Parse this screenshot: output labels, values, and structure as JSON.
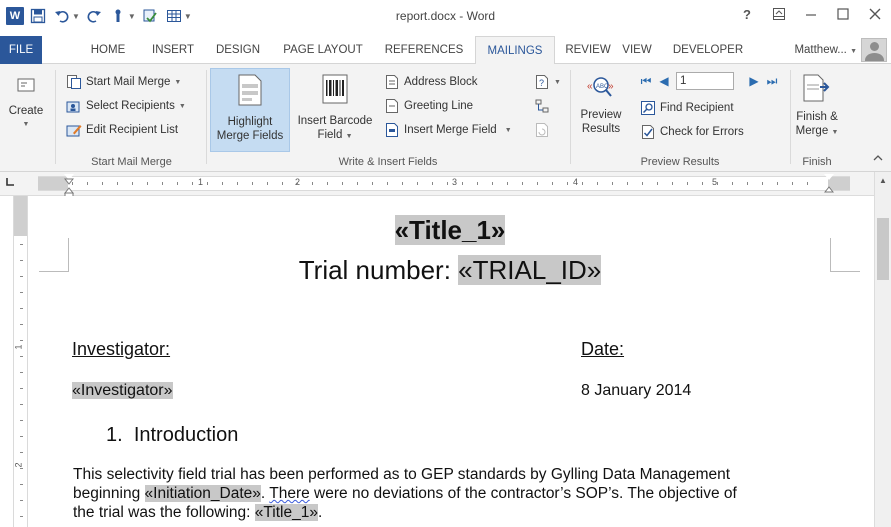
{
  "window": {
    "title": "report.docx - Word",
    "help": "?",
    "controls": [
      "restore-ribbon",
      "minimize",
      "maximize",
      "close"
    ]
  },
  "quick_access": {
    "logo_text": "W"
  },
  "tabs": [
    {
      "label": "FILE"
    },
    {
      "label": "HOME"
    },
    {
      "label": "INSERT"
    },
    {
      "label": "DESIGN"
    },
    {
      "label": "PAGE LAYOUT"
    },
    {
      "label": "REFERENCES"
    },
    {
      "label": "MAILINGS"
    },
    {
      "label": "REVIEW"
    },
    {
      "label": "VIEW"
    },
    {
      "label": "DEVELOPER"
    }
  ],
  "active_tab": "MAILINGS",
  "account": "Matthew...",
  "ribbon": {
    "create": {
      "label": "Create"
    },
    "start_mail_merge": {
      "group_label": "Start Mail Merge",
      "start": "Start Mail Merge",
      "select": "Select Recipients",
      "edit": "Edit Recipient List"
    },
    "write_insert": {
      "group_label": "Write & Insert Fields",
      "highlight_line1": "Highlight",
      "highlight_line2": "Merge Fields",
      "barcode_line1": "Insert Barcode",
      "barcode_line2": "Field",
      "address_block": "Address Block",
      "greeting_line": "Greeting Line",
      "insert_merge_field": "Insert Merge Field"
    },
    "preview": {
      "group_label": "Preview Results",
      "preview_line1": "Preview",
      "preview_line2": "Results",
      "record_value": "1",
      "find_recipient": "Find Recipient",
      "check_errors": "Check for Errors"
    },
    "finish": {
      "group_label": "Finish",
      "finish_line1": "Finish &",
      "finish_line2": "Merge"
    }
  },
  "ruler": {
    "numbers": [
      "1",
      "2",
      "3",
      "4",
      "5"
    ],
    "vertical_numbers": [
      "1",
      "2"
    ]
  },
  "document": {
    "title_field": "«Title_1»",
    "trial_prefix": "Trial number: ",
    "trial_field": "«TRIAL_ID»",
    "investigator_label": "Investigator:",
    "date_label": "Date:",
    "investigator_field": "«Investigator»",
    "date_value": "8 January 2014",
    "heading_number": "1.",
    "heading_text": "Introduction",
    "para_1": "This selectivity field trial has been performed as to GEP standards by Gylling Data Management",
    "para_2a": "beginning ",
    "para_2_field": "«Initiation_Date»",
    "para_2b": ". ",
    "para_2_squiggle": "There",
    "para_2c": " were no deviations of the contractor’s SOP’s. The objective of",
    "para_3a": "the trial was the following: ",
    "para_3_field": "«Title_1»",
    "para_3b": "."
  }
}
